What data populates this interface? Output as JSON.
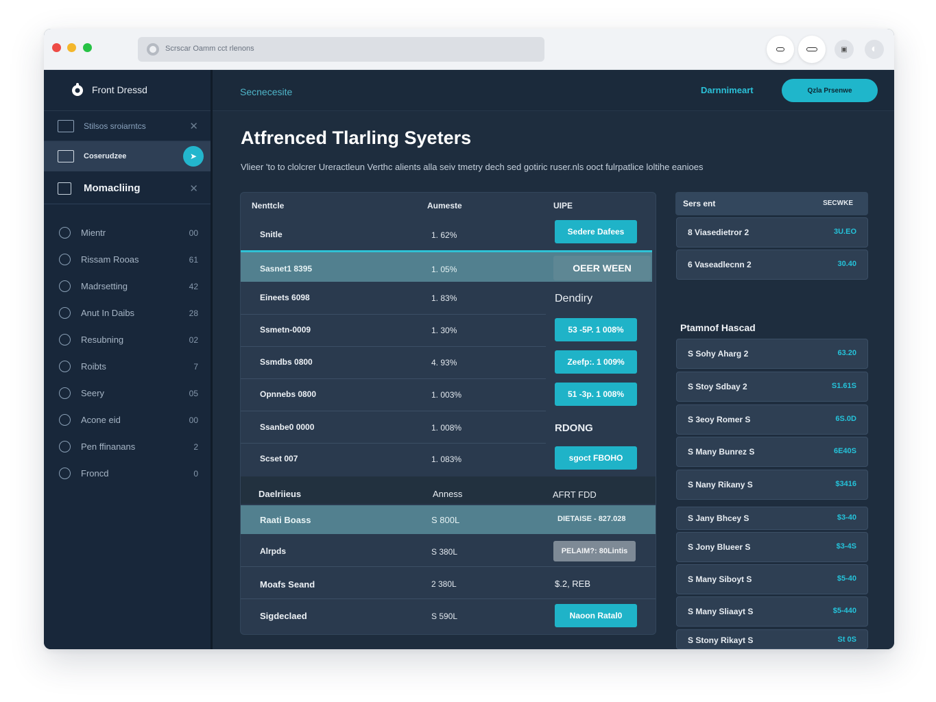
{
  "browser": {
    "address": "Scrscar Oamm cct rlenons"
  },
  "sidebar": {
    "brand": "Front Dressd",
    "top_items": [
      {
        "label": "Stilsos sroiarntcs"
      },
      {
        "label": "Coserudzee"
      },
      {
        "label": "Momacliing"
      }
    ],
    "items": [
      {
        "label": "Mientr",
        "count": "00"
      },
      {
        "label": "Rissam Rooas",
        "count": "61"
      },
      {
        "label": "Madrsetting",
        "count": "42"
      },
      {
        "label": "Anut In Daibs",
        "count": "28"
      },
      {
        "label": "Resubning",
        "count": "02"
      },
      {
        "label": "Roibts",
        "count": "7"
      },
      {
        "label": "Seery",
        "count": "05"
      },
      {
        "label": "Acone eid",
        "count": "00"
      },
      {
        "label": "Pen ffinanans",
        "count": "2"
      },
      {
        "label": "Froncd",
        "count": "0"
      }
    ]
  },
  "topbar": {
    "breadcrumb": "Secnecesite",
    "link": "Darnnimeart",
    "cta": "Qzla Prsenwe"
  },
  "page": {
    "title": "Atfrenced Tlarling Syeters",
    "subtitle": "Vlieer 'to to clolcrer Ureractleun Verthc alients alla seiv tmetry dech sed gotiric ruser.nls ooct fulrpatlice loltihe eanioes"
  },
  "table": {
    "headers": [
      "Nenttcle",
      "Aumeste",
      "UIPE"
    ],
    "rows": [
      {
        "name": "Snitle",
        "value": "1. 62%",
        "action": "Sedere Dafees",
        "kind": "button"
      },
      {
        "name": "Sasnet1 8395",
        "value": "1. 05%",
        "action": "OEER WEEN",
        "kind": "segment"
      },
      {
        "name": "Eineets 6098",
        "value": "1. 83%",
        "action": "Dendiry",
        "kind": "text"
      },
      {
        "name": "Ssmetn-0009",
        "value": "1. 30%",
        "action": "53 -5P. 1 008%",
        "kind": "button"
      },
      {
        "name": "Ssmdbs 0800",
        "value": "4. 93%",
        "action": "Zeefp:. 1 009%",
        "kind": "button"
      },
      {
        "name": "Opnnebs 0800",
        "value": "1. 003%",
        "action": "51 -3p. 1 008%",
        "kind": "button"
      },
      {
        "name": "Ssanbe0 0000",
        "value": "1. 008%",
        "action": "RDONG",
        "kind": "text"
      },
      {
        "name": "Scset 007",
        "value": "1. 083%",
        "action": "sgoct FBOHO",
        "kind": "button"
      }
    ],
    "section_headers": [
      "Daelriieus",
      "Anness",
      "AFRT FDD"
    ],
    "section_rows": [
      {
        "name": "Raati Boass",
        "value": "S 800L",
        "action": "DIETAISE - 827.028",
        "kind": "highlight"
      },
      {
        "name": "Alrpds",
        "value": "S 380L",
        "action": "PELAIM?: 80Lintis",
        "kind": "gray"
      },
      {
        "name": "Moafs Seand",
        "value": "2 380L",
        "action": "$.2, REB",
        "kind": "text"
      },
      {
        "name": "Sigdeclaed",
        "value": "S 590L",
        "action": "Naoon Ratal0",
        "kind": "button"
      }
    ]
  },
  "right_panel": {
    "header": {
      "left": "Sers ent",
      "right": "SECWKE"
    },
    "top_cards": [
      {
        "name": "8 Viasedietror 2",
        "value": "3U.EO"
      },
      {
        "name": "6 Vaseadlecnn 2",
        "value": "30.40"
      }
    ],
    "section_title": "Ptamnof Hascad",
    "cards": [
      {
        "name": "S Sohy Aharg 2",
        "value": "63.20"
      },
      {
        "name": "S Stoy Sdbay 2",
        "value": "S1.61S"
      },
      {
        "name": "S 3eoy Romer S",
        "value": "6S.0D"
      },
      {
        "name": "S Many Bunrez S",
        "value": "6E40S"
      },
      {
        "name": "S Nany Rikany S",
        "value": "$3416"
      },
      {
        "name": "S Jany Bhcey S",
        "value": "$3-40"
      },
      {
        "name": "S Jony Blueer S",
        "value": "$3-4S"
      },
      {
        "name": "S Many Siboyt S",
        "value": "$5-40"
      },
      {
        "name": "S Many Sliaayt S",
        "value": "$5-440"
      },
      {
        "name": "S Stony Rikayt S",
        "value": "St 0S"
      }
    ]
  },
  "colors": {
    "accent": "#1fb6cb",
    "sidebar_bg": "#18273a",
    "main_bg": "#1e2d3e",
    "highlight_row": "#52808f"
  }
}
